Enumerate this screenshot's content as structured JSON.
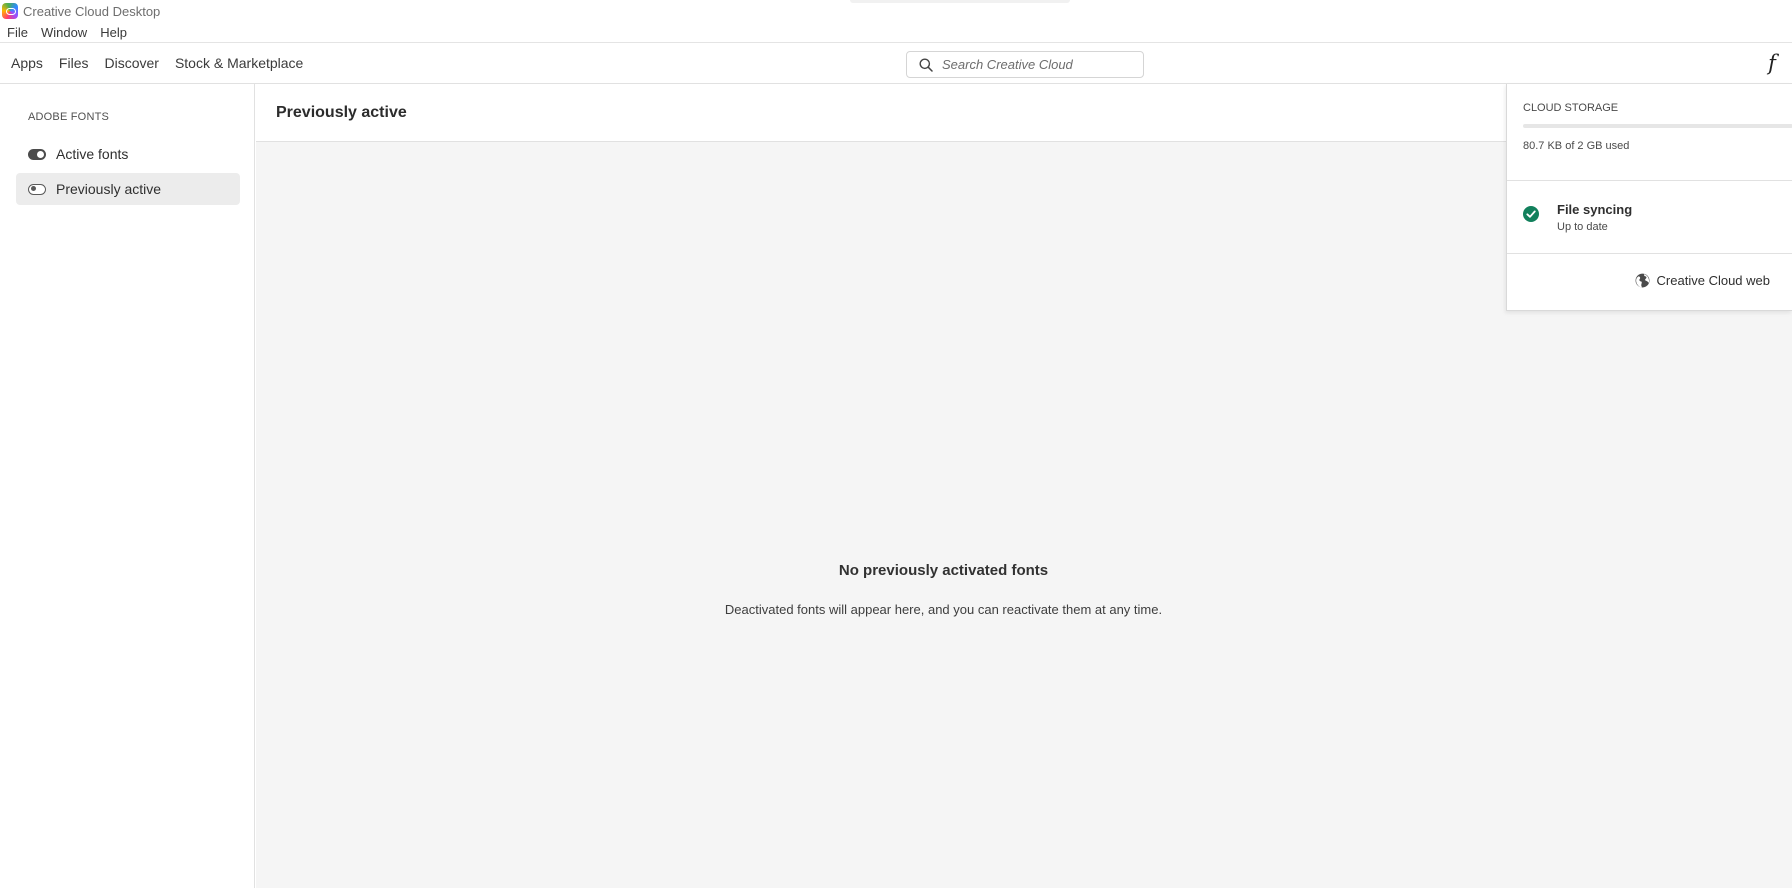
{
  "window": {
    "title": "Creative Cloud Desktop"
  },
  "menu": [
    "File",
    "Window",
    "Help"
  ],
  "nav": {
    "tabs": [
      "Apps",
      "Files",
      "Discover",
      "Stock & Marketplace"
    ],
    "search_placeholder": "Search Creative Cloud",
    "fonts_glyph": "f"
  },
  "sidebar": {
    "heading": "ADOBE FONTS",
    "items": [
      {
        "label": "Active fonts",
        "icon": "toggle-on-icon"
      },
      {
        "label": "Previously active",
        "icon": "toggle-off-icon"
      }
    ]
  },
  "main": {
    "title": "Previously active",
    "empty_title": "No previously activated fonts",
    "empty_desc": "Deactivated fonts will appear here, and you can reactivate them at any time."
  },
  "storage": {
    "label": "CLOUD STORAGE",
    "used_text": "80.7 KB of 2 GB used",
    "used_fraction": 4e-05,
    "sync_title": "File syncing",
    "sync_status": "Up to date",
    "web_link": "Creative Cloud web",
    "sync_color": "#12805c"
  }
}
